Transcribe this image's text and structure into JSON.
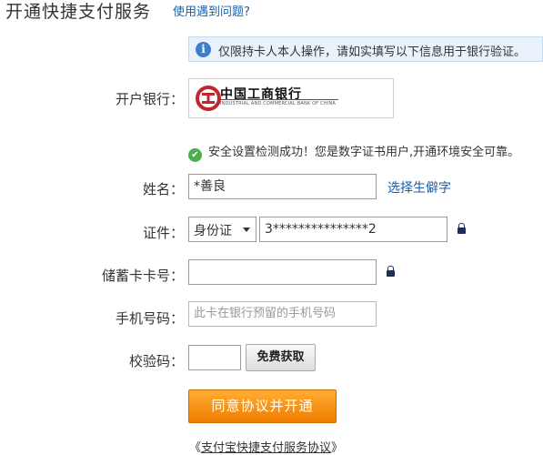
{
  "header": {
    "title": "开通快捷支付服务",
    "help_link": "使用遇到问题?"
  },
  "notice": {
    "icon": "info-icon",
    "text": "仅限持卡人本人操作，请如实填写以下信息用于银行验证。"
  },
  "bank": {
    "label": "开户银行：",
    "name": "中国工商银行",
    "name_en": "INDUSTRIAL AND COMMERCIAL BANK OF CHINA",
    "brand_color": "#c0272d"
  },
  "security": {
    "icon": "check-circle-icon",
    "text": "安全设置检测成功！您是数字证书用户,开通环境安全可靠。"
  },
  "form": {
    "name": {
      "label": "姓名：",
      "value": "*善良",
      "rare_char_link": "选择生僻字"
    },
    "id": {
      "label": "证件：",
      "type_value": "身份证",
      "number_value": "3***************2"
    },
    "card": {
      "label": "储蓄卡卡号：",
      "value": ""
    },
    "phone": {
      "label": "手机号码：",
      "placeholder": "此卡在银行预留的手机号码"
    },
    "code": {
      "label": "校验码：",
      "value": "",
      "get_button": "免费获取"
    }
  },
  "submit": {
    "label": "同意协议并开通",
    "color": "#f28a00"
  },
  "agreement": {
    "prefix": "《",
    "link": "支付宝快捷支付服务协议",
    "suffix": "》"
  },
  "colors": {
    "link": "#1a5ea8",
    "notice_bg": "#e9f2fb",
    "success": "#4cae4c"
  }
}
